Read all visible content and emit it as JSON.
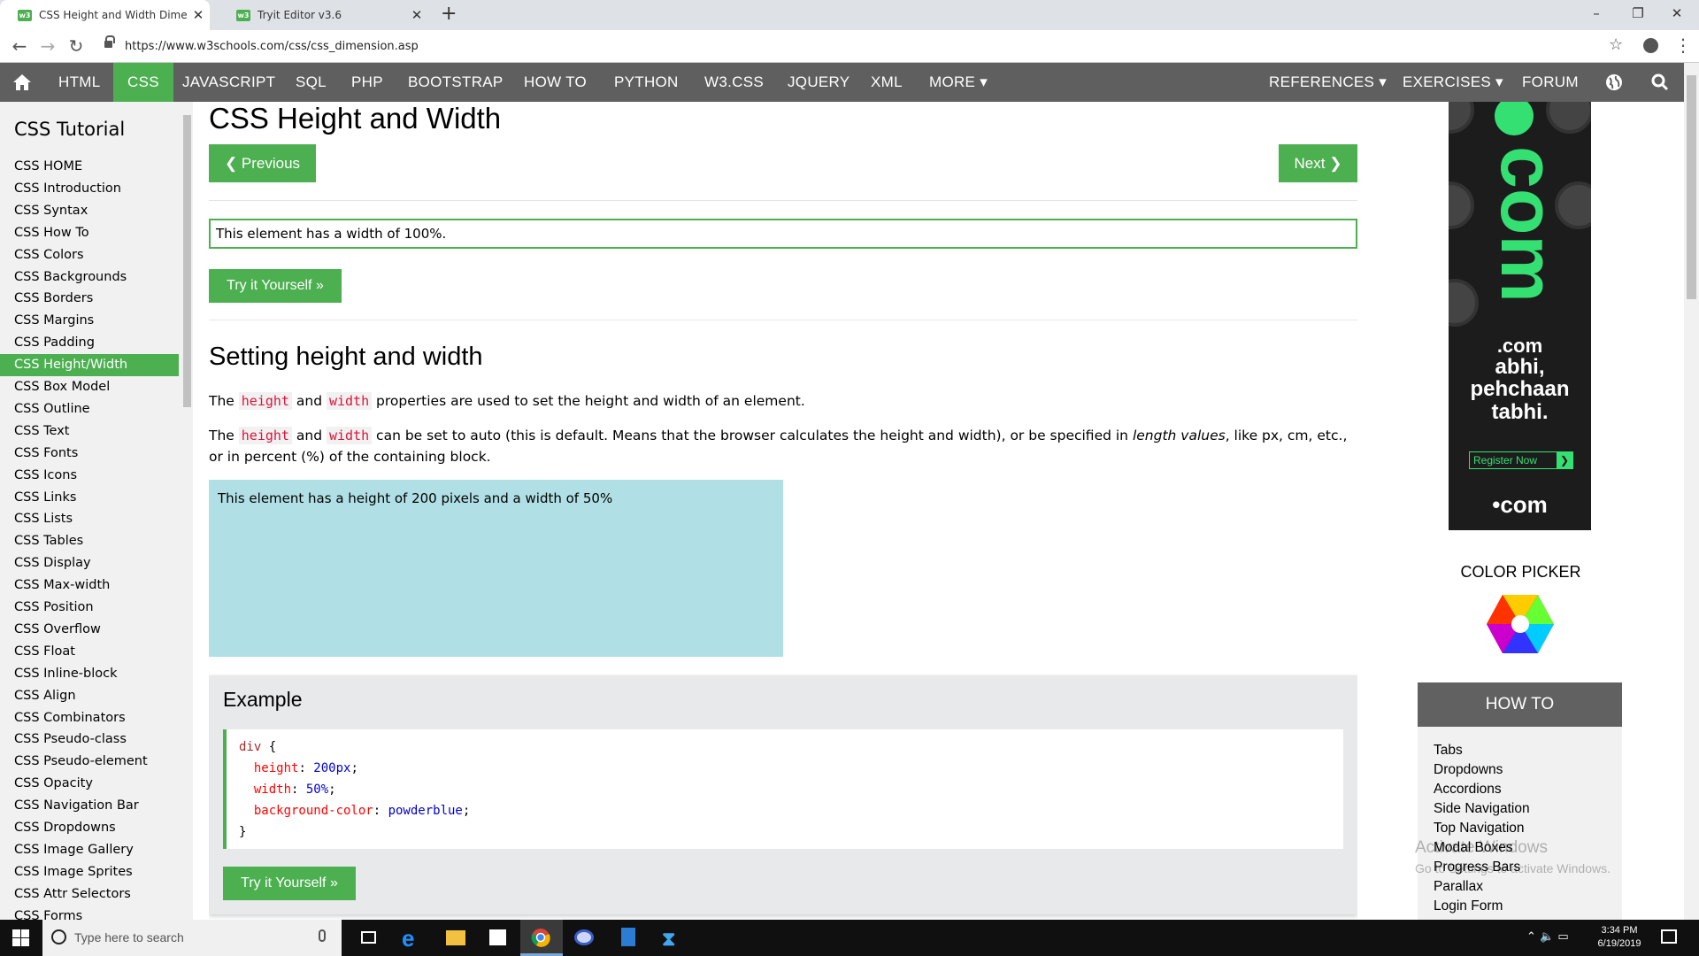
{
  "browser": {
    "tabs": [
      {
        "title": "CSS Height and Width Dimensio",
        "favicon": "w3"
      },
      {
        "title": "Tryit Editor v3.6",
        "favicon": "w3"
      }
    ],
    "close_glyph": "✕",
    "new_tab_glyph": "+",
    "url": "https://www.w3schools.com/css/css_dimension.asp",
    "window_controls": [
      "–",
      "❐",
      "✕"
    ]
  },
  "topnav": {
    "items": [
      "HTML",
      "CSS",
      "JAVASCRIPT",
      "SQL",
      "PHP",
      "BOOTSTRAP",
      "HOW TO",
      "PYTHON",
      "W3.CSS",
      "JQUERY",
      "XML",
      "MORE ▾"
    ],
    "active": "CSS",
    "right_items": [
      "REFERENCES ▾",
      "EXERCISES ▾",
      "FORUM"
    ],
    "accent": "#4caf50",
    "bar_color": "#5f5f5f"
  },
  "sidebar": {
    "title": "CSS Tutorial",
    "items": [
      "CSS HOME",
      "CSS Introduction",
      "CSS Syntax",
      "CSS How To",
      "CSS Colors",
      "CSS Backgrounds",
      "CSS Borders",
      "CSS Margins",
      "CSS Padding",
      "CSS Height/Width",
      "CSS Box Model",
      "CSS Outline",
      "CSS Text",
      "CSS Fonts",
      "CSS Icons",
      "CSS Links",
      "CSS Lists",
      "CSS Tables",
      "CSS Display",
      "CSS Max-width",
      "CSS Position",
      "CSS Overflow",
      "CSS Float",
      "CSS Inline-block",
      "CSS Align",
      "CSS Combinators",
      "CSS Pseudo-class",
      "CSS Pseudo-element",
      "CSS Opacity",
      "CSS Navigation Bar",
      "CSS Dropdowns",
      "CSS Image Gallery",
      "CSS Image Sprites",
      "CSS Attr Selectors",
      "CSS Forms"
    ],
    "active": "CSS Height/Width"
  },
  "main": {
    "title": "CSS Height and Width",
    "prev_label": "❮ Previous",
    "next_label": "Next ❯",
    "demo_100_text": "This element has a width of 100%.",
    "try_label": "Try it Yourself »",
    "section_title": "Setting height and width",
    "para1": {
      "t1": "The ",
      "c1": "height",
      "t2": " and ",
      "c2": "width",
      "t3": " properties are used to set the height and width of an element."
    },
    "para2": {
      "t1": "The ",
      "c1": "height",
      "t2": " and ",
      "c2": "width",
      "t3": " can be set to auto (this is default. Means that the browser calculates the height and width), or be specified in ",
      "em": "length values",
      "t4": ", like px, cm, etc., or in percent (%) of the containing block."
    },
    "demo_box_text": "This element has a height of 200 pixels and a width of 50%",
    "demo_box_color": "#b0e0e6",
    "example": {
      "title": "Example",
      "code": {
        "selector": "div",
        "open": " {",
        "rules": [
          {
            "prop": "height",
            "val": "200px"
          },
          {
            "prop": "width",
            "val": "50%"
          },
          {
            "prop": "background-color",
            "val": "powderblue"
          }
        ],
        "close": "}"
      }
    }
  },
  "ad": {
    "big_text": "com",
    "line1": ".com",
    "line2": "abhi,",
    "line3": "pehchaan",
    "line4": "tabhi.",
    "register": "Register Now",
    "brand": "•com",
    "accent": "#35e073"
  },
  "right": {
    "color_picker_title": "COLOR PICKER",
    "howto_title": "HOW TO",
    "howto_items": [
      "Tabs",
      "Dropdowns",
      "Accordions",
      "Side Navigation",
      "Top Navigation",
      "Modal Boxes",
      "Progress Bars",
      "Parallax",
      "Login Form"
    ]
  },
  "watermark": {
    "line1": "Activate Windows",
    "line2": "Go to Settings to activate Windows."
  },
  "taskbar": {
    "search_placeholder": "Type here to search",
    "time": "3:34 PM",
    "date": "6/19/2019"
  }
}
